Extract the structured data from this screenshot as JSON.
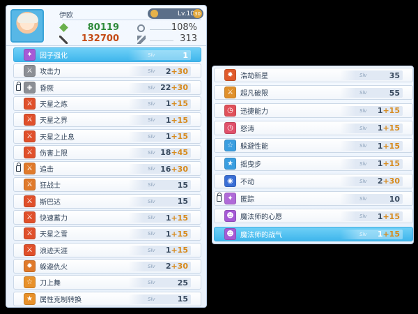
{
  "character": {
    "name": "伊欧",
    "level": "Lv.100",
    "level_badge": "30",
    "power": "80119",
    "attack": "132700",
    "crit": "108%",
    "speed": "313"
  },
  "level_prefix": "Slv",
  "left_skills": [
    {
      "name": "因子强化",
      "level": "1",
      "bonus": "",
      "color": "#a65ad6",
      "glyph": "✦",
      "selected": true,
      "locked": false
    },
    {
      "name": "攻击力",
      "level": "2",
      "bonus": "+30",
      "color": "#8c8f95",
      "glyph": "⚔",
      "selected": false,
      "locked": false
    },
    {
      "name": "昏厥",
      "level": "22",
      "bonus": "+30",
      "color": "#8c8f95",
      "glyph": "◈",
      "selected": false,
      "locked": true
    },
    {
      "name": "天星之炼",
      "level": "1",
      "bonus": "+15",
      "color": "#e0502b",
      "glyph": "⚔",
      "selected": false,
      "locked": false
    },
    {
      "name": "天星之界",
      "level": "1",
      "bonus": "+15",
      "color": "#e0502b",
      "glyph": "⚔",
      "selected": false,
      "locked": false
    },
    {
      "name": "天星之止息",
      "level": "1",
      "bonus": "+15",
      "color": "#e0502b",
      "glyph": "⚔",
      "selected": false,
      "locked": false
    },
    {
      "name": "伤害上限",
      "level": "18",
      "bonus": "+45",
      "color": "#e0502b",
      "glyph": "⚔",
      "selected": false,
      "locked": false
    },
    {
      "name": "追击",
      "level": "16",
      "bonus": "+30",
      "color": "#e07a2b",
      "glyph": "⚔",
      "selected": false,
      "locked": true
    },
    {
      "name": "狂战士",
      "level": "15",
      "bonus": "",
      "color": "#e07a2b",
      "glyph": "⚔",
      "selected": false,
      "locked": false
    },
    {
      "name": "斯巴达",
      "level": "15",
      "bonus": "",
      "color": "#e0502b",
      "glyph": "⚔",
      "selected": false,
      "locked": false
    },
    {
      "name": "快速蓄力",
      "level": "1",
      "bonus": "+15",
      "color": "#e0502b",
      "glyph": "⚔",
      "selected": false,
      "locked": false
    },
    {
      "name": "天星之雪",
      "level": "1",
      "bonus": "+15",
      "color": "#e0502b",
      "glyph": "⚔",
      "selected": false,
      "locked": false
    },
    {
      "name": "浪迹天涯",
      "level": "1",
      "bonus": "+15",
      "color": "#e0502b",
      "glyph": "⚔",
      "selected": false,
      "locked": false
    },
    {
      "name": "躲避仇火",
      "level": "2",
      "bonus": "+30",
      "color": "#e07a2b",
      "glyph": "✹",
      "selected": false,
      "locked": false
    },
    {
      "name": "刀上舞",
      "level": "25",
      "bonus": "",
      "color": "#e8912a",
      "glyph": "☆",
      "selected": false,
      "locked": false
    },
    {
      "name": "属性克制转换",
      "level": "15",
      "bonus": "",
      "color": "#e8912a",
      "glyph": "★",
      "selected": false,
      "locked": false
    }
  ],
  "right_skills": [
    {
      "name": "浩劫新星",
      "level": "35",
      "bonus": "",
      "color": "#e05a2b",
      "glyph": "✹",
      "selected": false,
      "locked": false
    },
    {
      "name": "超凡破限",
      "level": "55",
      "bonus": "",
      "color": "#e0902b",
      "glyph": "⚔",
      "selected": false,
      "locked": false
    },
    {
      "name": "迅捷能力",
      "level": "1",
      "bonus": "+15",
      "color": "#e0505a",
      "glyph": "◷",
      "selected": false,
      "locked": false
    },
    {
      "name": "怒涛",
      "level": "1",
      "bonus": "+15",
      "color": "#e0506a",
      "glyph": "◷",
      "selected": false,
      "locked": false
    },
    {
      "name": "躲避性能",
      "level": "1",
      "bonus": "+15",
      "color": "#3a9ee0",
      "glyph": "☆",
      "selected": false,
      "locked": false
    },
    {
      "name": "摇曳步",
      "level": "1",
      "bonus": "+15",
      "color": "#3a9ee0",
      "glyph": "★",
      "selected": false,
      "locked": false
    },
    {
      "name": "不动",
      "level": "2",
      "bonus": "+30",
      "color": "#3a6fd6",
      "glyph": "◉",
      "selected": false,
      "locked": false
    },
    {
      "name": "匿踪",
      "level": "10",
      "bonus": "",
      "color": "#b06ad8",
      "glyph": "✦",
      "selected": false,
      "locked": true
    },
    {
      "name": "魔法师的心愿",
      "level": "1",
      "bonus": "+15",
      "color": "#a65ad6",
      "glyph": "☻",
      "selected": false,
      "locked": false
    },
    {
      "name": "魔法师的战气",
      "level": "1",
      "bonus": "+15",
      "color": "#a65ad6",
      "glyph": "☻",
      "selected": true,
      "locked": false
    }
  ]
}
